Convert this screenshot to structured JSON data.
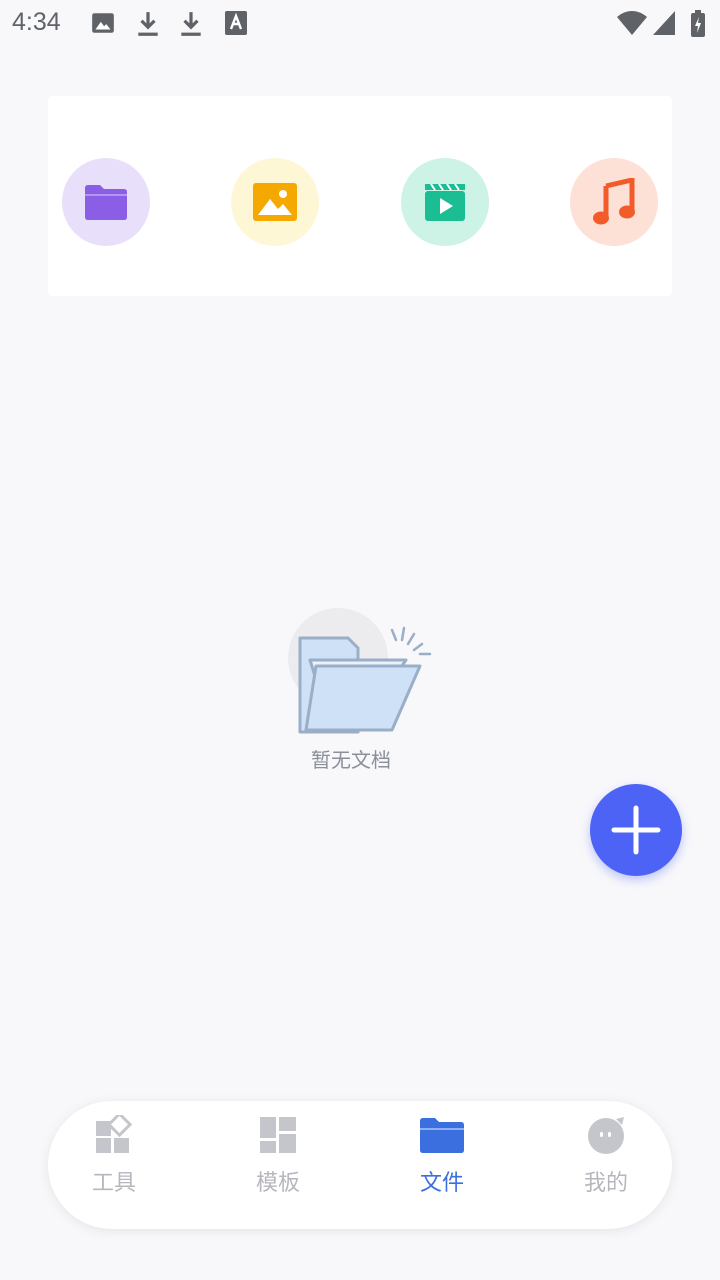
{
  "status_bar": {
    "time": "4:34",
    "notification_icons": [
      "image-icon",
      "download-icon",
      "download-icon",
      "text-icon"
    ],
    "system_icons": [
      "wifi-icon",
      "signal-icon",
      "battery-charging-icon"
    ]
  },
  "categories": [
    {
      "name": "folder-icon",
      "bg": "#e8e0fa",
      "color": "#8b5ee6"
    },
    {
      "name": "image-icon",
      "bg": "#fdf7d6",
      "color": "#f5a800"
    },
    {
      "name": "video-icon",
      "bg": "#cdf2e6",
      "color": "#1bbd93"
    },
    {
      "name": "music-icon",
      "bg": "#fde0d6",
      "color": "#f25c2a"
    }
  ],
  "empty_state": {
    "message": "暂无文档"
  },
  "fab": {
    "icon": "plus-icon",
    "color": "#4c63f5"
  },
  "bottom_nav": {
    "items": [
      {
        "label": "工具",
        "icon": "tools-icon",
        "active": false
      },
      {
        "label": "模板",
        "icon": "template-icon",
        "active": false
      },
      {
        "label": "文件",
        "icon": "folder-icon",
        "active": true
      },
      {
        "label": "我的",
        "icon": "profile-icon",
        "active": false
      }
    ],
    "active_color": "#3b6fe0",
    "inactive_color": "#b5b7bd"
  }
}
